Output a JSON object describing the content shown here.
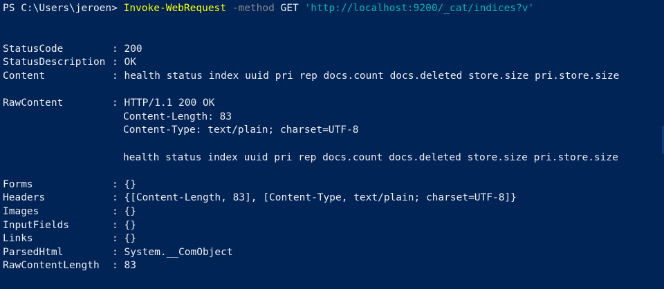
{
  "prompt": {
    "ps": "PS C:\\Users\\jeroen> ",
    "cmdlet": "Invoke-WebRequest",
    "param": " -method ",
    "method_value": "GET",
    "space": " ",
    "url": "'http://localhost:9200/_cat/indices?v'"
  },
  "output": {
    "status_code": {
      "name": "StatusCode",
      "value": "200"
    },
    "status_description": {
      "name": "StatusDescription",
      "value": "OK"
    },
    "content": {
      "name": "Content",
      "value": "health status index uuid pri rep docs.count docs.deleted store.size pri.store.size"
    },
    "raw_content": {
      "name": "RawContent",
      "lines": [
        "HTTP/1.1 200 OK",
        "Content-Length: 83",
        "Content-Type: text/plain; charset=UTF-8",
        "",
        "health status index uuid pri rep docs.count docs.deleted store.size pri.store.size"
      ]
    },
    "forms": {
      "name": "Forms",
      "value": "{}"
    },
    "headers": {
      "name": "Headers",
      "value": "{[Content-Length, 83], [Content-Type, text/plain; charset=UTF-8]}"
    },
    "images": {
      "name": "Images",
      "value": "{}"
    },
    "input_fields": {
      "name": "InputFields",
      "value": "{}"
    },
    "links": {
      "name": "Links",
      "value": "{}"
    },
    "parsed_html": {
      "name": "ParsedHtml",
      "value": "System.__ComObject"
    },
    "raw_content_length": {
      "name": "RawContentLength",
      "value": "83"
    },
    "separator": ": "
  },
  "colors": {
    "background": "#012456",
    "text": "#eeedf0",
    "cmdlet": "#ffff00",
    "parameter": "#8a8a8a",
    "string": "#00b4b4"
  }
}
